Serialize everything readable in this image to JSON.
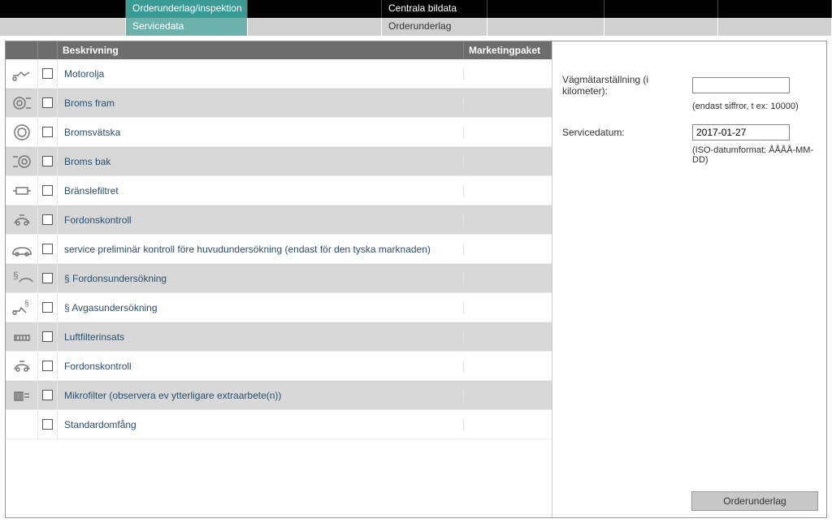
{
  "topnav": {
    "tabs": [
      "",
      "Orderunderlag/inspektion",
      "",
      "Centrala bildata",
      "",
      "",
      ""
    ]
  },
  "subnav": {
    "tabs": [
      "",
      "Servicedata",
      "",
      "Orderunderlag",
      "",
      "",
      ""
    ]
  },
  "table": {
    "headers": {
      "description": "Beskrivning",
      "marketing": "Marketingpaket"
    },
    "rows": [
      {
        "icon": "oil",
        "label": "Motorolja"
      },
      {
        "icon": "brake-front",
        "label": "Broms fram"
      },
      {
        "icon": "brake-fluid",
        "label": "Bromsvätska"
      },
      {
        "icon": "brake-rear",
        "label": "Broms bak"
      },
      {
        "icon": "fuel-filter",
        "label": "Bränslefiltret"
      },
      {
        "icon": "vehicle-check",
        "label": "Fordonskontroll"
      },
      {
        "icon": "car",
        "label": "service preliminär kontroll före huvudundersökning (endast för den tyska marknaden)"
      },
      {
        "icon": "inspection",
        "label": "§ Fordonsundersökning"
      },
      {
        "icon": "exhaust-test",
        "label": "§ Avgasundersökning"
      },
      {
        "icon": "air-filter",
        "label": "Luftfilterinsats"
      },
      {
        "icon": "vehicle-check",
        "label": "Fordonskontroll"
      },
      {
        "icon": "microfilter",
        "label": "Mikrofilter (observera ev ytterligare extraarbete(n))"
      },
      {
        "icon": "",
        "label": "Standardomfång"
      }
    ]
  },
  "form": {
    "odometer": {
      "label": "Vägmätarställning (i kilometer):",
      "value": "",
      "hint": "(endast siffror, t ex: 10000)"
    },
    "servicedate": {
      "label": "Servicedatum:",
      "value": "2017-01-27",
      "hint": "(ISO-datumformat: ÅÅÅÅ-MM-DD)"
    }
  },
  "footer": {
    "button": "Orderunderlag"
  }
}
